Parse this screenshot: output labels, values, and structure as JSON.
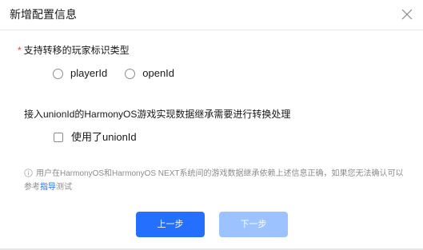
{
  "dialog": {
    "title": "新增配置信息",
    "close_icon": "close-icon"
  },
  "player_id_type": {
    "required_mark": "*",
    "label": "支持转移的玩家标识类型",
    "options": [
      {
        "label": "playerId",
        "selected": false
      },
      {
        "label": "openId",
        "selected": false
      }
    ]
  },
  "unionid_section": {
    "label": "接入unionId的HarmonyOS游戏实现数据继承需要进行转换处理",
    "checkbox_label": "使用了unionId",
    "checked": false
  },
  "note": {
    "icon": "info-circle-icon",
    "text_before": "用户在HarmonyOS和HarmonyOS NEXT系统间的游戏数据继承依赖上述信息正确，如果您无法确认可以参考",
    "link_text": "指导",
    "text_after": "测试"
  },
  "footer": {
    "prev_label": "上一步",
    "next_label": "下一步",
    "next_disabled": true
  },
  "colors": {
    "primary": "#256fff",
    "primary_disabled": "#9cc3ff",
    "required": "#e84026",
    "muted_text": "#8c8c8c"
  }
}
